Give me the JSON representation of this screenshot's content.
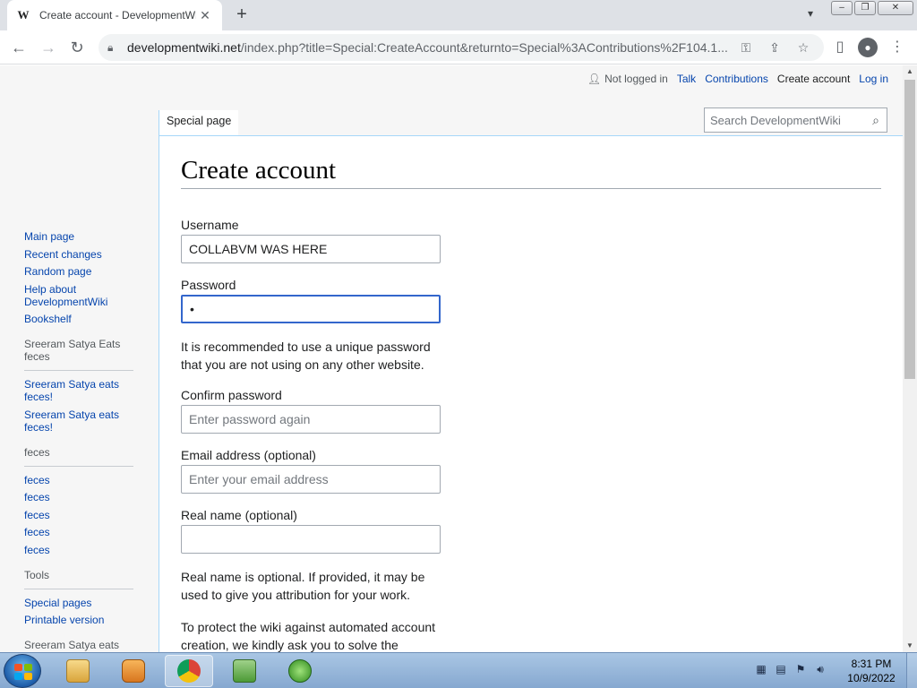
{
  "browser": {
    "tab_title": "Create account - DevelopmentWiki",
    "tab_favicon": "W",
    "url_host": "developmentwiki.net",
    "url_rest": "/index.php?title=Special:CreateAccount&returnto=Special%3AContributions%2F104.1..."
  },
  "personal": {
    "not_logged_in": "Not logged in",
    "talk": "Talk",
    "contributions": "Contributions",
    "create_account": "Create account",
    "log_in": "Log in"
  },
  "tabs": {
    "special_page": "Special page"
  },
  "search": {
    "placeholder": "Search DevelopmentWiki"
  },
  "sidebar": {
    "nav": [
      "Main page",
      "Recent changes",
      "Random page",
      "Help about DevelopmentWiki",
      "Bookshelf"
    ],
    "portal1": {
      "heading": "Sreeram Satya Eats feces",
      "items": [
        "Sreeram Satya eats feces!",
        "Sreeram Satya eats feces!"
      ]
    },
    "portal2": {
      "heading": "feces",
      "items": [
        "feces",
        "feces",
        "feces",
        "feces",
        "feces"
      ]
    },
    "portal3": {
      "heading": "Tools",
      "items": [
        "Special pages",
        "Printable version"
      ]
    },
    "portal4": {
      "heading": "Sreeram Satya eats"
    }
  },
  "form": {
    "heading": "Create account",
    "username_label": "Username",
    "username_value": "COLLABVM WAS HERE",
    "password_label": "Password",
    "password_value": "•",
    "password_help": "It is recommended to use a unique password that you are not using on any other website.",
    "confirm_label": "Confirm password",
    "confirm_placeholder": "Enter password again",
    "email_label": "Email address (optional)",
    "email_placeholder": "Enter your email address",
    "realname_label": "Real name (optional)",
    "realname_help": "Real name is optional. If provided, it may be used to give you attribution for your work.",
    "captcha_help": "To protect the wiki against automated account creation, we kindly ask you to solve the following task below and enter the answer in"
  },
  "taskbar": {
    "time": "8:31 PM",
    "date": "10/9/2022"
  },
  "colors": {
    "link": "#0645ad",
    "focus": "#3366cc",
    "border": "#a2a9b1"
  }
}
